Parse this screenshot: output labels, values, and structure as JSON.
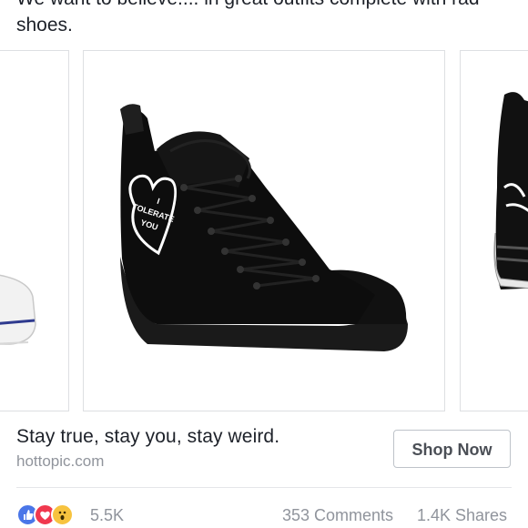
{
  "post": {
    "text": "We want to believe.... in great outfits complete with rad shoes."
  },
  "carousel": {
    "items": [
      {
        "name": "white-sneaker-partial"
      },
      {
        "name": "black-hightop-tolerate-you",
        "shoe_print": [
          "I",
          "TOLERATE",
          "YOU"
        ]
      },
      {
        "name": "black-hightop-partial"
      }
    ]
  },
  "ad": {
    "caption": "Stay true, stay you, stay weird.",
    "domain": "hottopic.com",
    "cta_label": "Shop Now"
  },
  "engagement": {
    "reaction_icons": [
      "like-icon",
      "love-icon",
      "wow-icon"
    ],
    "reaction_count": "5.5K",
    "comments": "353 Comments",
    "shares": "1.4K Shares"
  },
  "colors": {
    "text": "#1d2129",
    "muted": "#90949c",
    "like": "#4a76e8",
    "love": "#f0384e",
    "wow": "#f7c33f"
  }
}
